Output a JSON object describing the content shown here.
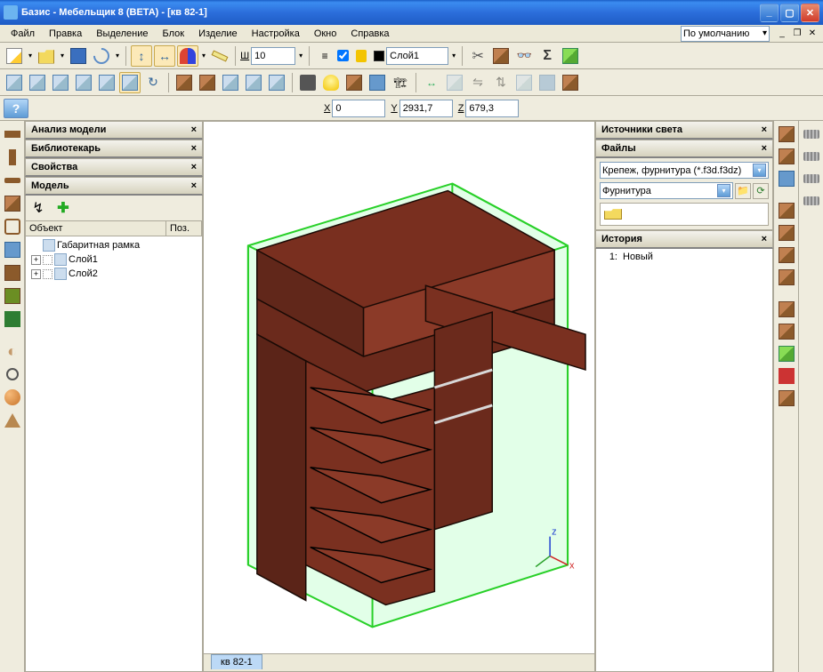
{
  "titlebar": {
    "text": "Базис - Мебельщик 8 (BETA) - [кв 82-1]"
  },
  "menu": {
    "file": "Файл",
    "edit": "Правка",
    "select": "Выделение",
    "block": "Блок",
    "product": "Изделие",
    "setup": "Настройка",
    "window": "Окно",
    "help": "Справка",
    "workspace": "По умолчанию"
  },
  "toolbar2": {
    "width_label": "Ш",
    "width_value": "10",
    "layer": "Слой1"
  },
  "coords": {
    "x_label": "X",
    "x": "0",
    "y_label": "Y",
    "y": "2931,7",
    "z_label": "Z",
    "z": "679,3"
  },
  "panels": {
    "analysis": "Анализ модели",
    "librarian": "Библиотекарь",
    "properties": "Свойства",
    "model": "Модель",
    "object_col": "Объект",
    "pos_col": "Поз.",
    "tree": {
      "root": "Габаритная рамка",
      "layer1": "Слой1",
      "layer2": "Слой2"
    },
    "light": "Источники света",
    "files": "Файлы",
    "file_filter": "Крепеж, фурнитура (*.f3d.f3dz)",
    "file_type": "Фурнитура",
    "history": "История",
    "history1_num": "1:",
    "history1": "Новый"
  },
  "doc_tab": "кв 82-1"
}
